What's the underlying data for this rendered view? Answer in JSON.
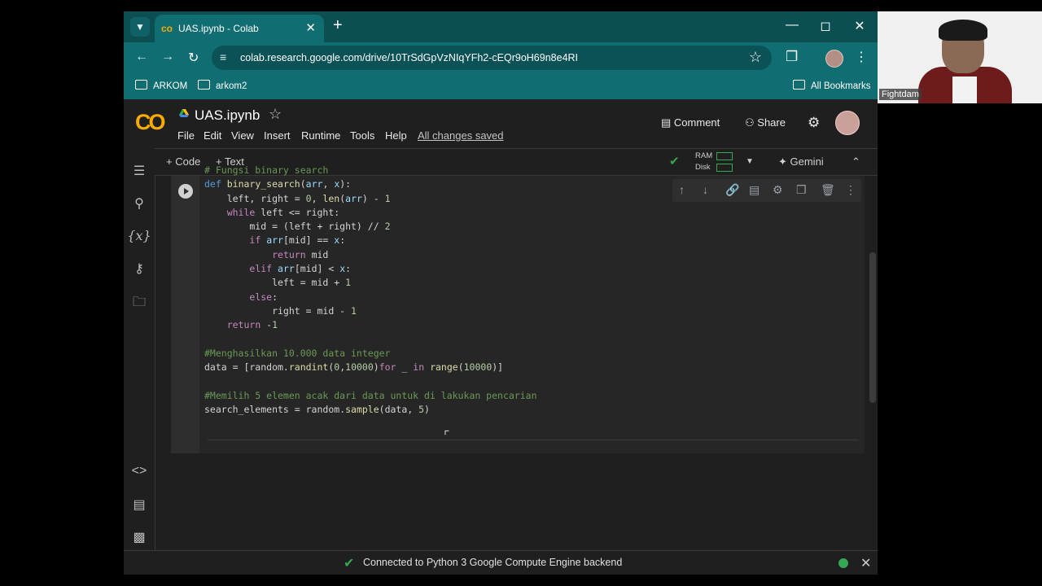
{
  "browser": {
    "tab_title": "UAS.ipynb - Colab",
    "url": "colab.research.google.com/drive/10TrSdGpVzNIqYFh2-cEQr9oH69n8e4RI",
    "bookmarks": [
      "ARKOM",
      "arkom2"
    ],
    "all_bookmarks": "All Bookmarks"
  },
  "colab": {
    "logo": "CO",
    "notebook_name": "UAS.ipynb",
    "menu": [
      "File",
      "Edit",
      "View",
      "Insert",
      "Runtime",
      "Tools",
      "Help"
    ],
    "save_status": "All changes saved",
    "comment_label": "Comment",
    "share_label": "Share"
  },
  "toolbar": {
    "code_label": "Code",
    "text_label": "Text",
    "ram_label": "RAM",
    "disk_label": "Disk",
    "gemini_label": "Gemini"
  },
  "cell": {
    "lines": [
      "# Fungsi binary search",
      "def binary_search(arr, x):",
      "    left, right = 0, len(arr) - 1",
      "    while left <= right:",
      "        mid = (left + right) // 2",
      "        if arr[mid] == x:",
      "            return mid",
      "        elif arr[mid] < x:",
      "            left = mid + 1",
      "        else:",
      "            right = mid - 1",
      "    return -1",
      "",
      "#Menghasilkan 10.000 data integer",
      "data = [random.randint(0,10000)for _ in range(10000)]",
      "",
      "#Memilih 5 elemen acak dari data untuk di lakukan pencarian",
      "search_elements = random.sample(data, 5)"
    ]
  },
  "status": {
    "text": "Connected to Python 3 Google Compute Engine backend"
  },
  "webcam": {
    "label": "Fightdam"
  },
  "colors": {
    "tab_bar": "#0b4f52",
    "colab_bg": "#1f1f1f",
    "accent": "#f9ab00",
    "success": "#34a853"
  }
}
